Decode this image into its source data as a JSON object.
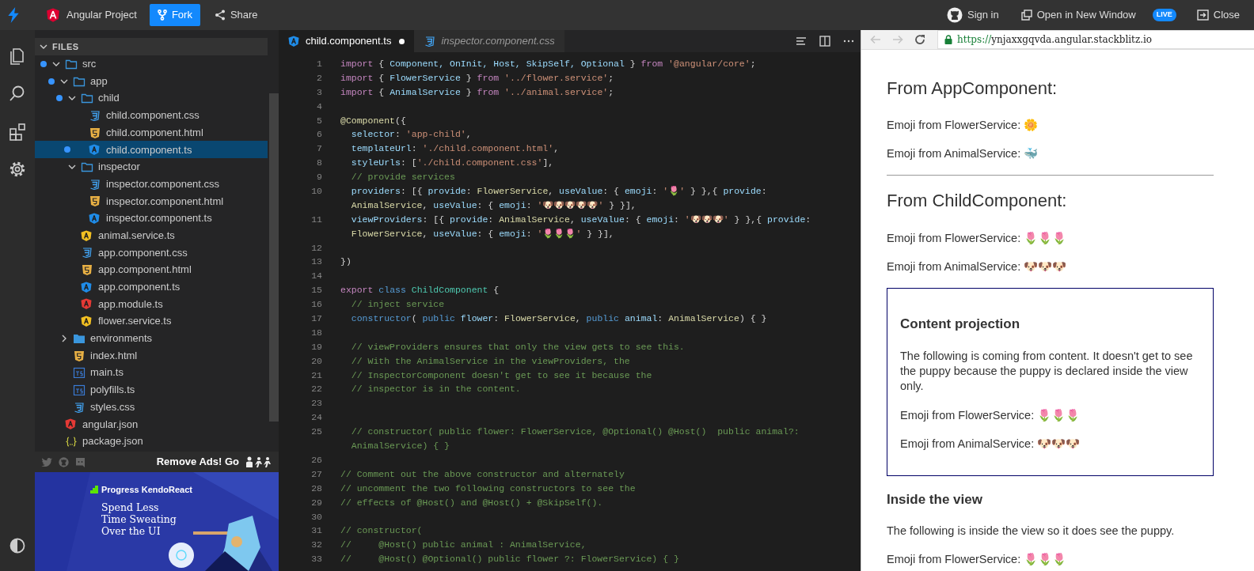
{
  "topbar": {
    "project": "Angular Project",
    "buttons": [
      {
        "label": "Fork",
        "kind": "primary"
      },
      {
        "label": "Share",
        "kind": "share"
      }
    ],
    "sign_in": "Sign in",
    "open_window": "Open in New Window",
    "live_badge": "LIVE",
    "close": "Close"
  },
  "sidebar": {
    "title": "FILES",
    "expanded": true,
    "tree": [
      {
        "name": "src",
        "kind": "folder",
        "expanded": true,
        "modified": true,
        "selected": false,
        "children": [
          {
            "name": "app",
            "kind": "folder",
            "expanded": true,
            "modified": true,
            "selected": false,
            "children": [
              {
                "name": "child",
                "kind": "folder",
                "expanded": true,
                "modified": true,
                "selected": false,
                "children": [
                  {
                    "name": "child.component.css",
                    "kind": "css",
                    "modified": false,
                    "selected": false
                  },
                  {
                    "name": "child.component.html",
                    "kind": "html",
                    "modified": false,
                    "selected": false
                  },
                  {
                    "name": "child.component.ts",
                    "kind": "component",
                    "modified": true,
                    "selected": true
                  }
                ]
              },
              {
                "name": "inspector",
                "kind": "folder",
                "expanded": true,
                "modified": false,
                "selected": false,
                "children": [
                  {
                    "name": "inspector.component.css",
                    "kind": "css",
                    "modified": false,
                    "selected": false
                  },
                  {
                    "name": "inspector.component.html",
                    "kind": "html",
                    "modified": false,
                    "selected": false
                  },
                  {
                    "name": "inspector.component.ts",
                    "kind": "component",
                    "modified": false,
                    "selected": false
                  }
                ]
              },
              {
                "name": "animal.service.ts",
                "kind": "service",
                "modified": false,
                "selected": false
              },
              {
                "name": "app.component.css",
                "kind": "css",
                "modified": false,
                "selected": false
              },
              {
                "name": "app.component.html",
                "kind": "html",
                "modified": false,
                "selected": false
              },
              {
                "name": "app.component.ts",
                "kind": "component",
                "modified": false,
                "selected": false
              },
              {
                "name": "app.module.ts",
                "kind": "module",
                "modified": false,
                "selected": false
              },
              {
                "name": "flower.service.ts",
                "kind": "service",
                "modified": false,
                "selected": false
              }
            ]
          },
          {
            "name": "environments",
            "kind": "folder",
            "expanded": false,
            "modified": false,
            "selected": false
          },
          {
            "name": "index.html",
            "kind": "html",
            "modified": false,
            "selected": false
          },
          {
            "name": "main.ts",
            "kind": "ts",
            "modified": false,
            "selected": false
          },
          {
            "name": "polyfills.ts",
            "kind": "ts",
            "modified": false,
            "selected": false
          },
          {
            "name": "styles.css",
            "kind": "css",
            "modified": false,
            "selected": false
          }
        ]
      },
      {
        "name": "angular.json",
        "kind": "module",
        "modified": false,
        "selected": false
      },
      {
        "name": "package.json",
        "kind": "json",
        "modified": false,
        "selected": false
      }
    ],
    "remove_ads": "Remove Ads! Go",
    "ad": {
      "brand": "Progress KendoReact",
      "headline": "Spend Less\nTime Sweating\nOver the UI"
    }
  },
  "editor": {
    "tabs": [
      {
        "label": "child.component.ts",
        "kind": "component",
        "selected": true,
        "modified": true,
        "preview": false
      },
      {
        "label": "inspector.component.css",
        "kind": "css",
        "selected": false,
        "modified": false,
        "preview": true
      }
    ],
    "lines": [
      {
        "number": "1",
        "tokens": [
          {
            "kind": "kw",
            "text": "import"
          },
          {
            "kind": "p",
            "text": " { "
          },
          {
            "kind": "id",
            "text": "Component, OnInit, Host, SkipSelf, Optional"
          },
          {
            "kind": "p",
            "text": " } "
          },
          {
            "kind": "kw",
            "text": "from"
          },
          {
            "kind": "str",
            "text": " '@angular/core'"
          },
          {
            "kind": "p",
            "text": ";"
          }
        ]
      },
      {
        "number": "2",
        "tokens": [
          {
            "kind": "kw",
            "text": "import"
          },
          {
            "kind": "p",
            "text": " { "
          },
          {
            "kind": "id",
            "text": "FlowerService"
          },
          {
            "kind": "p",
            "text": " } "
          },
          {
            "kind": "kw",
            "text": "from"
          },
          {
            "kind": "str",
            "text": " '../flower.service'"
          },
          {
            "kind": "p",
            "text": ";"
          }
        ]
      },
      {
        "number": "3",
        "tokens": [
          {
            "kind": "kw",
            "text": "import"
          },
          {
            "kind": "p",
            "text": " { "
          },
          {
            "kind": "id",
            "text": "AnimalService"
          },
          {
            "kind": "p",
            "text": " } "
          },
          {
            "kind": "kw",
            "text": "from"
          },
          {
            "kind": "str",
            "text": " '../animal.service'"
          },
          {
            "kind": "p",
            "text": ";"
          }
        ]
      },
      {
        "number": "4"
      },
      {
        "number": "5",
        "tokens": [
          {
            "kind": "fn",
            "text": "@Component"
          },
          {
            "kind": "p",
            "text": "({"
          }
        ]
      },
      {
        "number": "6",
        "tokens": [
          {
            "kind": "id",
            "text": "  selector"
          },
          {
            "kind": "p",
            "text": ": "
          },
          {
            "kind": "str",
            "text": "'app-child'"
          },
          {
            "kind": "p",
            "text": ","
          }
        ]
      },
      {
        "number": "7",
        "tokens": [
          {
            "kind": "id",
            "text": "  templateUrl"
          },
          {
            "kind": "p",
            "text": ": "
          },
          {
            "kind": "str",
            "text": "'./child.component.html'"
          },
          {
            "kind": "p",
            "text": ","
          }
        ]
      },
      {
        "number": "8",
        "tokens": [
          {
            "kind": "id",
            "text": "  styleUrls"
          },
          {
            "kind": "p",
            "text": ": ["
          },
          {
            "kind": "str",
            "text": "'./child.component.css'"
          },
          {
            "kind": "p",
            "text": "],"
          }
        ]
      },
      {
        "number": "9",
        "tokens": [
          {
            "kind": "cm",
            "text": "  // provide services"
          }
        ]
      },
      {
        "number": "10",
        "tokens": [
          {
            "kind": "id",
            "text": "  providers"
          },
          {
            "kind": "p",
            "text": ": [{ "
          },
          {
            "kind": "id",
            "text": "provide"
          },
          {
            "kind": "p",
            "text": ": "
          },
          {
            "kind": "type",
            "text": "FlowerService"
          },
          {
            "kind": "p",
            "text": ", "
          },
          {
            "kind": "id",
            "text": "useValue"
          },
          {
            "kind": "p",
            "text": ": { "
          },
          {
            "kind": "id",
            "text": "emoji"
          },
          {
            "kind": "p",
            "text": ": "
          },
          {
            "kind": "str",
            "text": "'🌷'"
          },
          {
            "kind": "p",
            "text": " } },{ "
          },
          {
            "kind": "id",
            "text": "provide"
          },
          {
            "kind": "p",
            "text": ":"
          }
        ]
      },
      {
        "tokens": [
          {
            "kind": "type",
            "text": "  AnimalService"
          },
          {
            "kind": "p",
            "text": ", "
          },
          {
            "kind": "id",
            "text": "useValue"
          },
          {
            "kind": "p",
            "text": ": { "
          },
          {
            "kind": "id",
            "text": "emoji"
          },
          {
            "kind": "p",
            "text": ": "
          },
          {
            "kind": "str",
            "text": "'🐶🐶🐶🐶🐶'"
          },
          {
            "kind": "p",
            "text": " } }],"
          }
        ]
      },
      {
        "number": "11",
        "tokens": [
          {
            "kind": "id",
            "text": "  viewProviders"
          },
          {
            "kind": "p",
            "text": ": [{ "
          },
          {
            "kind": "id",
            "text": "provide"
          },
          {
            "kind": "p",
            "text": ": "
          },
          {
            "kind": "type",
            "text": "AnimalService"
          },
          {
            "kind": "p",
            "text": ", "
          },
          {
            "kind": "id",
            "text": "useValue"
          },
          {
            "kind": "p",
            "text": ": { "
          },
          {
            "kind": "id",
            "text": "emoji"
          },
          {
            "kind": "p",
            "text": ": "
          },
          {
            "kind": "str",
            "text": "'🐶🐶🐶'"
          },
          {
            "kind": "p",
            "text": " } },{ "
          },
          {
            "kind": "id",
            "text": "provide"
          },
          {
            "kind": "p",
            "text": ":"
          }
        ]
      },
      {
        "tokens": [
          {
            "kind": "type",
            "text": "  FlowerService"
          },
          {
            "kind": "p",
            "text": ", "
          },
          {
            "kind": "id",
            "text": "useValue"
          },
          {
            "kind": "p",
            "text": ": { "
          },
          {
            "kind": "id",
            "text": "emoji"
          },
          {
            "kind": "p",
            "text": ": "
          },
          {
            "kind": "str",
            "text": "'🌷🌷🌷'"
          },
          {
            "kind": "p",
            "text": " } }],"
          }
        ]
      },
      {
        "number": "12"
      },
      {
        "number": "13",
        "tokens": [
          {
            "kind": "p",
            "text": "})"
          }
        ]
      },
      {
        "number": "14"
      },
      {
        "number": "15",
        "tokens": [
          {
            "kind": "kw",
            "text": "export"
          },
          {
            "kind": "kw2",
            "text": " class"
          },
          {
            "kind": "cls",
            "text": " ChildComponent"
          },
          {
            "kind": "p",
            "text": " {"
          }
        ]
      },
      {
        "number": "16",
        "tokens": [
          {
            "kind": "cm",
            "text": "  // inject service"
          }
        ]
      },
      {
        "number": "17",
        "tokens": [
          {
            "kind": "kw2",
            "text": "  constructor"
          },
          {
            "kind": "p",
            "text": "( "
          },
          {
            "kind": "kw2",
            "text": "public"
          },
          {
            "kind": "id",
            "text": " flower"
          },
          {
            "kind": "p",
            "text": ": "
          },
          {
            "kind": "type",
            "text": "FlowerService"
          },
          {
            "kind": "p",
            "text": ", "
          },
          {
            "kind": "kw2",
            "text": "public"
          },
          {
            "kind": "id",
            "text": " animal"
          },
          {
            "kind": "p",
            "text": ": "
          },
          {
            "kind": "type",
            "text": "AnimalService"
          },
          {
            "kind": "p",
            "text": ") { }"
          }
        ]
      },
      {
        "number": "18"
      },
      {
        "number": "19",
        "tokens": [
          {
            "kind": "cm",
            "text": "  // viewProviders ensures that only the view gets to see this."
          }
        ]
      },
      {
        "number": "20",
        "tokens": [
          {
            "kind": "cm",
            "text": "  // With the AnimalService in the viewProviders, the"
          }
        ]
      },
      {
        "number": "21",
        "tokens": [
          {
            "kind": "cm",
            "text": "  // InspectorComponent doesn't get to see it because the"
          }
        ]
      },
      {
        "number": "22",
        "tokens": [
          {
            "kind": "cm",
            "text": "  // inspector is in the content."
          }
        ]
      },
      {
        "number": "23"
      },
      {
        "number": "24"
      },
      {
        "number": "25",
        "tokens": [
          {
            "kind": "cm",
            "text": "  // constructor( public flower: FlowerService, @Optional() @Host()  public animal?:"
          }
        ]
      },
      {
        "tokens": [
          {
            "kind": "cm",
            "text": "  AnimalService) { }"
          }
        ]
      },
      {
        "number": "26"
      },
      {
        "number": "27",
        "tokens": [
          {
            "kind": "cm",
            "text": "// Comment out the above constructor and alternately"
          }
        ]
      },
      {
        "number": "28",
        "tokens": [
          {
            "kind": "cm",
            "text": "// uncomment the two following constructors to see the"
          }
        ]
      },
      {
        "number": "29",
        "tokens": [
          {
            "kind": "cm",
            "text": "// effects of @Host() and @Host() + @SkipSelf()."
          }
        ]
      },
      {
        "number": "30"
      },
      {
        "number": "31",
        "tokens": [
          {
            "kind": "cm",
            "text": "// constructor("
          }
        ]
      },
      {
        "number": "32",
        "tokens": [
          {
            "kind": "cm",
            "text": "//     @Host() public animal : AnimalService,"
          }
        ]
      },
      {
        "number": "33",
        "tokens": [
          {
            "kind": "cm",
            "text": "//     @Host() @Optional() public flower ?: FlowerService) { }"
          }
        ]
      }
    ]
  },
  "preview": {
    "nav": [
      {
        "kind": "back",
        "disabled": true
      },
      {
        "kind": "forward",
        "disabled": true
      },
      {
        "kind": "reload",
        "disabled": false
      }
    ],
    "url_scheme": "https://",
    "url_host": "ynjaxxgqvda.angular.stackblitz.io",
    "blocks": [
      {
        "kind": "h2",
        "text": "From AppComponent:"
      },
      {
        "kind": "p",
        "text": "Emoji from FlowerService: 🌼"
      },
      {
        "kind": "p",
        "text": "Emoji from AnimalService: 🐳"
      },
      {
        "kind": "rule"
      },
      {
        "kind": "h2",
        "text": "From ChildComponent:"
      },
      {
        "kind": "p",
        "text": "Emoji from FlowerService: 🌷🌷🌷"
      },
      {
        "kind": "p",
        "text": "Emoji from AnimalService: 🐶🐶🐶"
      },
      {
        "kind": "box",
        "children": [
          {
            "kind": "h3",
            "text": "Content projection"
          },
          {
            "kind": "p",
            "text": "The following is coming from content. It doesn't get to see the puppy because the puppy is declared inside the view only."
          },
          {
            "kind": "p",
            "text": "Emoji from FlowerService: 🌷🌷🌷"
          },
          {
            "kind": "p",
            "text": "Emoji from AnimalService: 🐶🐶🐶"
          }
        ]
      },
      {
        "kind": "h3",
        "text": "Inside the view"
      },
      {
        "kind": "p",
        "text": "The following is inside the view so it does see the puppy."
      },
      {
        "kind": "p",
        "text": "Emoji from FlowerService: 🌷🌷🌷"
      }
    ]
  }
}
